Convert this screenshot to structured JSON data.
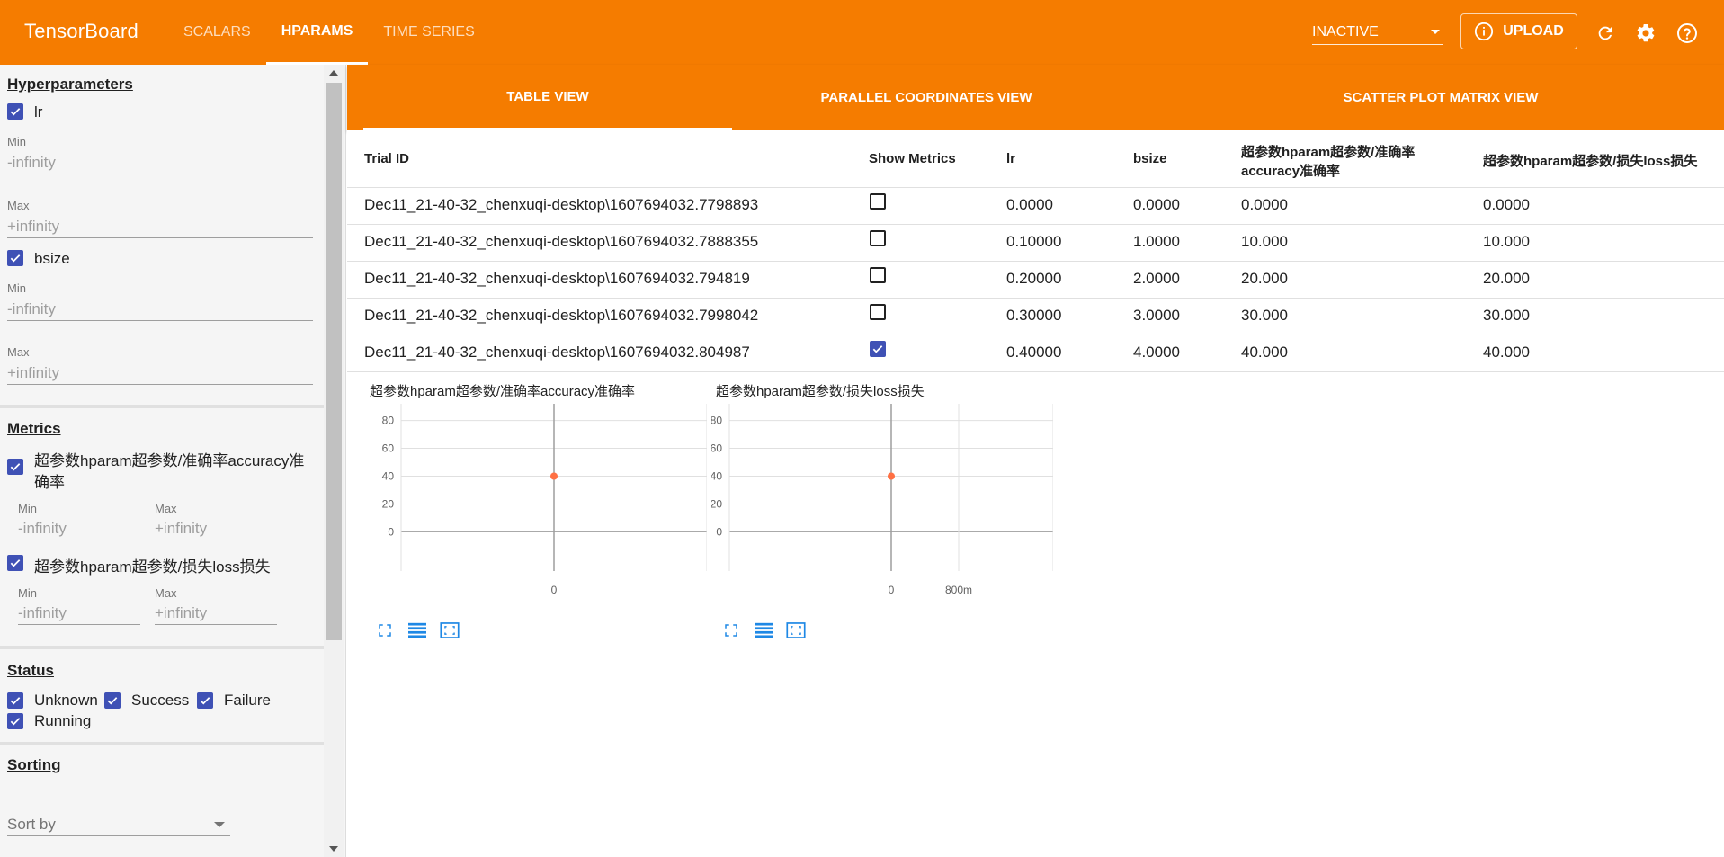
{
  "header": {
    "brand": "TensorBoard",
    "tabs": [
      {
        "label": "SCALARS"
      },
      {
        "label": "HPARAMS"
      },
      {
        "label": "TIME SERIES"
      }
    ],
    "run_status": "INACTIVE",
    "upload_label": "UPLOAD",
    "colors": {
      "header": "#f57c00",
      "checkbox": "#3f51b5",
      "point": "#ff7043"
    }
  },
  "sidebar": {
    "hyperparameters": {
      "title": "Hyperparameters",
      "items": [
        {
          "label": "lr",
          "min_label": "Min",
          "min_placeholder": "-infinity",
          "max_label": "Max",
          "max_placeholder": "+infinity"
        },
        {
          "label": "bsize",
          "min_label": "Min",
          "min_placeholder": "-infinity",
          "max_label": "Max",
          "max_placeholder": "+infinity"
        }
      ]
    },
    "metrics": {
      "title": "Metrics",
      "items": [
        {
          "label_line1": "超参数hparam超参数/准确率accuracy准",
          "label_line2": "确率",
          "min_label": "Min",
          "min_placeholder": "-infinity",
          "max_label": "Max",
          "max_placeholder": "+infinity"
        },
        {
          "label": "超参数hparam超参数/损失loss损失",
          "min_label": "Min",
          "min_placeholder": "-infinity",
          "max_label": "Max",
          "max_placeholder": "+infinity"
        }
      ]
    },
    "status": {
      "title": "Status",
      "items": [
        "Unknown",
        "Success",
        "Failure",
        "Running"
      ]
    },
    "sorting": {
      "title": "Sorting",
      "sort_by_placeholder": "Sort by"
    }
  },
  "view_tabs": [
    "TABLE VIEW",
    "PARALLEL COORDINATES VIEW",
    "SCATTER PLOT MATRIX VIEW"
  ],
  "table": {
    "headers": {
      "trial_id": "Trial ID",
      "show_metrics": "Show Metrics",
      "lr": "lr",
      "bsize": "bsize",
      "accuracy_line1": "超参数hparam超参数/准确率",
      "accuracy_line2": "accuracy准确率",
      "loss": "超参数hparam超参数/损失loss损失"
    },
    "rows": [
      {
        "trial_id": "Dec11_21-40-32_chenxuqi-desktop\\1607694032.7798893",
        "show": false,
        "lr": "0.0000",
        "bsize": "0.0000",
        "accuracy": "0.0000",
        "loss": "0.0000"
      },
      {
        "trial_id": "Dec11_21-40-32_chenxuqi-desktop\\1607694032.7888355",
        "show": false,
        "lr": "0.10000",
        "bsize": "1.0000",
        "accuracy": "10.000",
        "loss": "10.000"
      },
      {
        "trial_id": "Dec11_21-40-32_chenxuqi-desktop\\1607694032.794819",
        "show": false,
        "lr": "0.20000",
        "bsize": "2.0000",
        "accuracy": "20.000",
        "loss": "20.000"
      },
      {
        "trial_id": "Dec11_21-40-32_chenxuqi-desktop\\1607694032.7998042",
        "show": false,
        "lr": "0.30000",
        "bsize": "3.0000",
        "accuracy": "30.000",
        "loss": "30.000"
      },
      {
        "trial_id": "Dec11_21-40-32_chenxuqi-desktop\\1607694032.804987",
        "show": true,
        "lr": "0.40000",
        "bsize": "4.0000",
        "accuracy": "40.000",
        "loss": "40.000"
      }
    ]
  },
  "chart_data": [
    {
      "type": "scatter",
      "title": "超参数hparam超参数/准确率accuracy准确率",
      "x": [
        0
      ],
      "y": [
        40
      ],
      "x_ticks": [
        "0"
      ],
      "y_ticks": [
        "0",
        "20",
        "40",
        "60",
        "80"
      ],
      "ylim": [
        -12,
        92
      ],
      "xlabel": "",
      "ylabel": "",
      "grid": true
    },
    {
      "type": "scatter",
      "title": "超参数hparam超参数/损失loss损失",
      "x": [
        0
      ],
      "y": [
        40
      ],
      "x_ticks": [
        "0",
        "800m"
      ],
      "y_ticks": [
        "0",
        "20",
        "40",
        "60",
        "80"
      ],
      "ylim": [
        -12,
        92
      ],
      "xlabel": "",
      "ylabel": "",
      "grid": true
    }
  ]
}
